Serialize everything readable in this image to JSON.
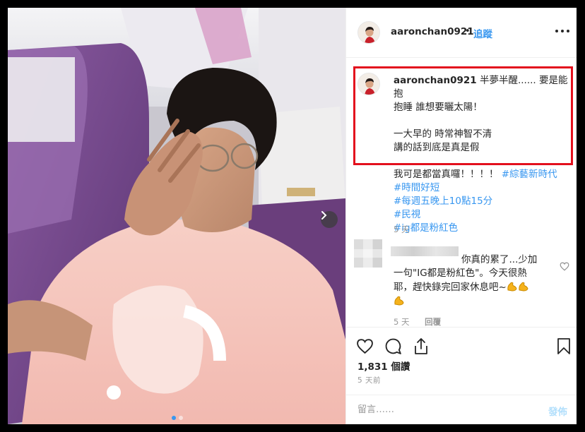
{
  "header": {
    "username": "aaronchan0921",
    "separator": "•",
    "follow_label": "追蹤",
    "more_icon": "more-options-icon"
  },
  "caption": {
    "username": "aaronchan0921",
    "line1": " 半夢半醒...... 要是能抱",
    "line2": "抱睡 誰想要曬太陽！",
    "line3": "一大早的 時常神智不清",
    "line4": "講的話到底是真是假",
    "line5_text": "我可是都當真囉！！！！ ",
    "hashtags": [
      "#綜藝新時代",
      "#時間好短",
      "#每週五晚上10點15分",
      "#民視",
      "#ig都是粉紅色"
    ],
    "time": "5 天"
  },
  "comment": {
    "line1": "你真的累了...少加",
    "line2": "一句\"IG都是粉紅色\"。今天很熱",
    "line3": "耶，趕快錄完回家休息吧~",
    "time": "5 天",
    "reply_label": "回覆"
  },
  "stats": {
    "likes": "1,831 個讚",
    "posted": "5 天前"
  },
  "add_comment": {
    "placeholder": "留言……",
    "post_label": "發佈"
  },
  "colors": {
    "link_blue": "#3897f0",
    "highlight_red": "#e3101d",
    "disabled_blue": "#b2dffc"
  }
}
